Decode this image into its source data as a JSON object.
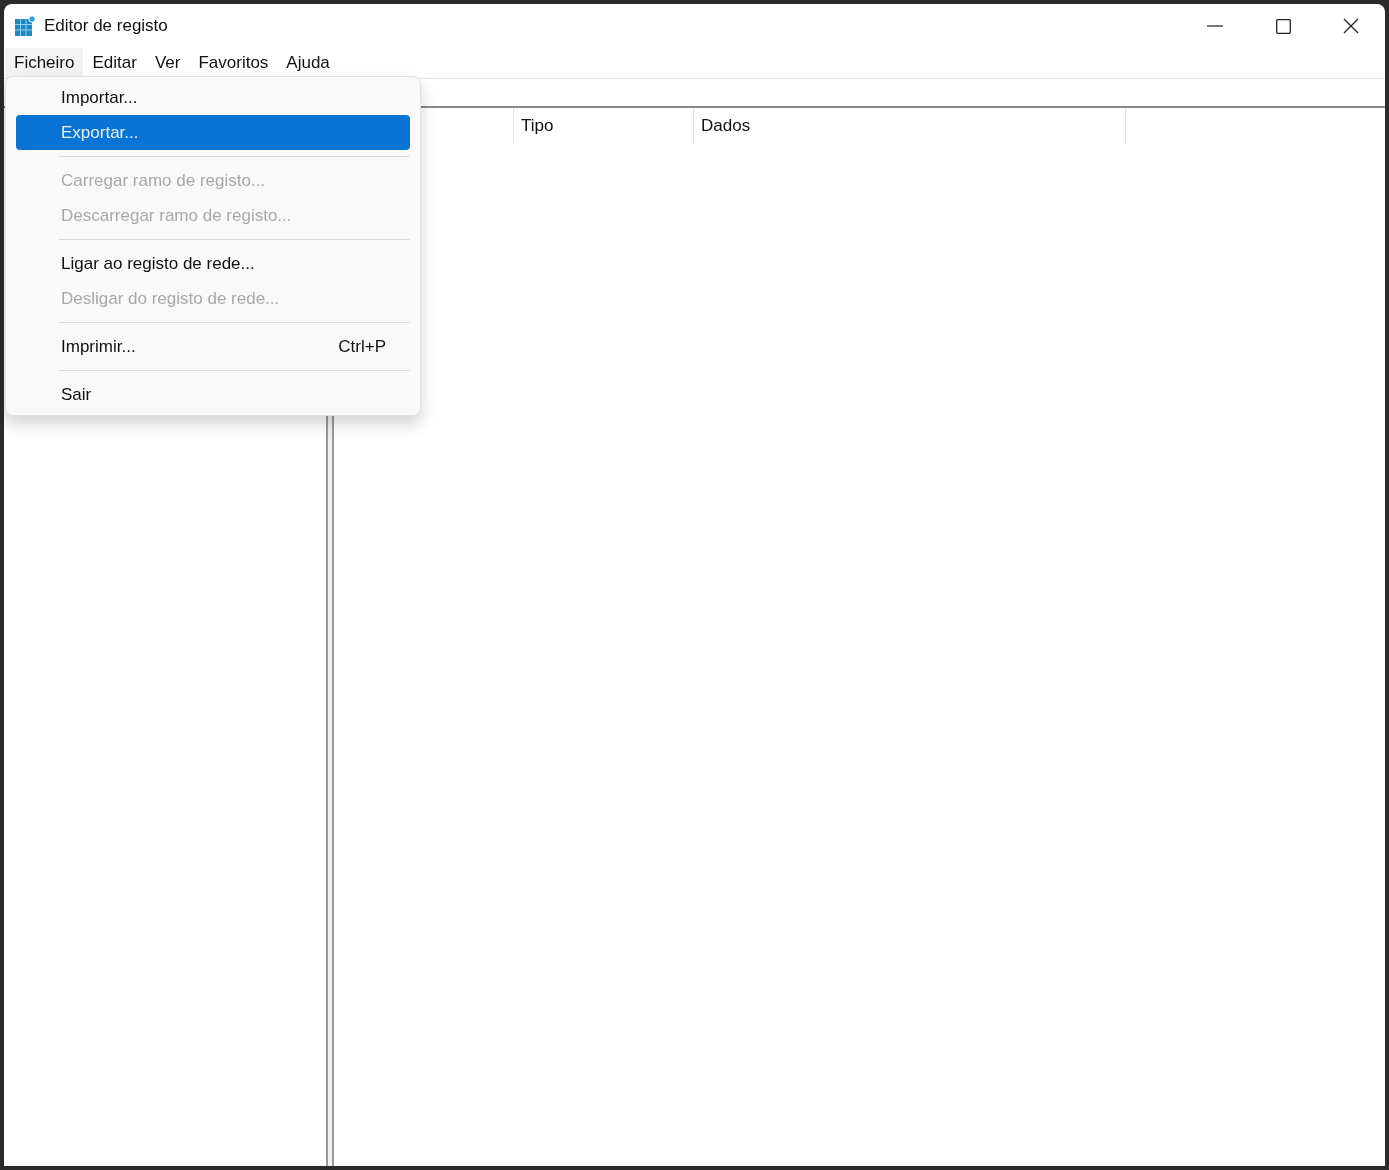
{
  "window": {
    "title": "Editor de registo"
  },
  "menu_bar": [
    {
      "label": "Ficheiro",
      "selected": true
    },
    {
      "label": "Editar",
      "selected": false
    },
    {
      "label": "Ver",
      "selected": false
    },
    {
      "label": "Favoritos",
      "selected": false
    },
    {
      "label": "Ajuda",
      "selected": false
    }
  ],
  "file_menu": [
    {
      "kind": "item",
      "label": "Importar...",
      "selected": false,
      "disabled": false
    },
    {
      "kind": "item",
      "label": "Exportar...",
      "selected": true,
      "disabled": false
    },
    {
      "kind": "separator"
    },
    {
      "kind": "item",
      "label": "Carregar ramo de registo...",
      "selected": false,
      "disabled": true
    },
    {
      "kind": "item",
      "label": "Descarregar ramo de registo...",
      "selected": false,
      "disabled": true
    },
    {
      "kind": "separator"
    },
    {
      "kind": "item",
      "label": "Ligar ao registo de rede...",
      "selected": false,
      "disabled": false
    },
    {
      "kind": "item",
      "label": "Desligar do registo de rede...",
      "selected": false,
      "disabled": true
    },
    {
      "kind": "separator"
    },
    {
      "kind": "item",
      "label": "Imprimir...",
      "shortcut": "Ctrl+P",
      "selected": false,
      "disabled": false
    },
    {
      "kind": "separator"
    },
    {
      "kind": "item",
      "label": "Sair",
      "selected": false,
      "disabled": false
    }
  ],
  "values_table": {
    "columns": [
      "Tipo",
      "Dados"
    ]
  }
}
